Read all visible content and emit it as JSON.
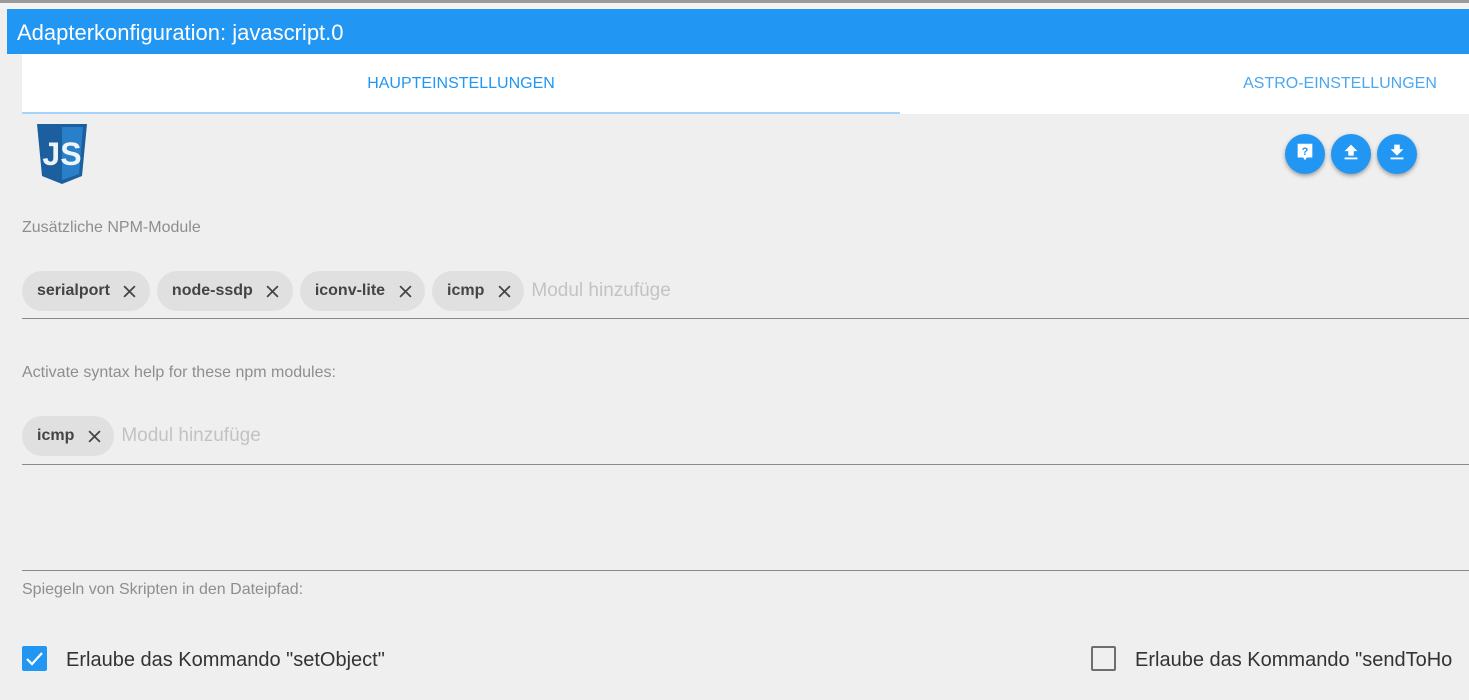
{
  "window": {
    "title": "Adapterkonfiguration: javascript.0"
  },
  "tabs": [
    {
      "label": "HAUPTEINSTELLUNGEN",
      "active": true
    },
    {
      "label": "ASTRO-EINSTELLUNGEN",
      "active": false
    }
  ],
  "logo": {
    "text": "JS"
  },
  "toolbar": {
    "buttons": [
      {
        "icon": "help-icon"
      },
      {
        "icon": "upload-icon"
      },
      {
        "icon": "download-icon"
      }
    ]
  },
  "npm_modules": {
    "label": "Zusätzliche NPM-Module",
    "chips": [
      "serialport",
      "node-ssdp",
      "iconv-lite",
      "icmp"
    ],
    "placeholder": "Modul hinzufüge"
  },
  "syntax_modules": {
    "label": "Activate syntax help for these npm modules:",
    "chips": [
      "icmp"
    ],
    "placeholder": "Modul hinzufüge"
  },
  "mirror": {
    "label": "Spiegeln von Skripten in den Dateipfad:"
  },
  "options": [
    {
      "label": "Erlaube das Kommando \"setObject\"",
      "checked": true
    },
    {
      "label": "Erlaube das Kommando \"sendToHo",
      "checked": false
    }
  ],
  "colors": {
    "accent": "#2196f3",
    "background": "#efefef",
    "chip": "#e0e0e0"
  }
}
